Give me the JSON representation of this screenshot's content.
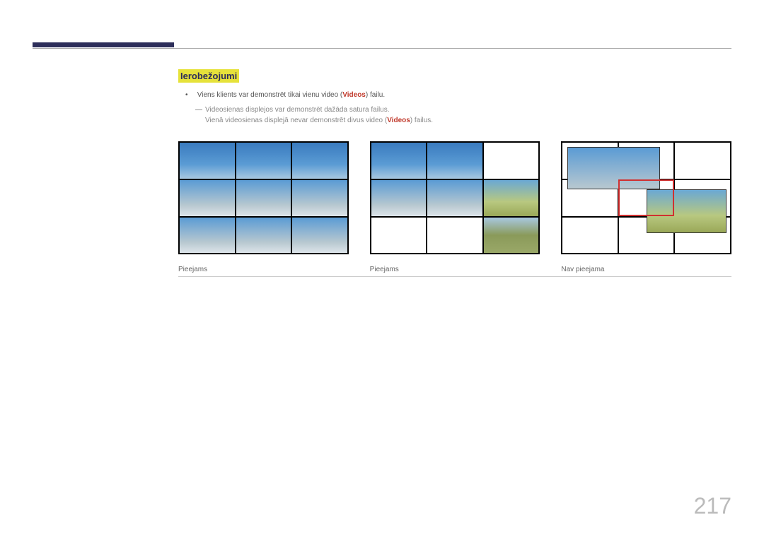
{
  "header": {},
  "section_title": "Ierobežojumi",
  "bullet1_pre": "Viens klients var demonstrēt tikai vienu video (",
  "bullet1_bold": "Videos",
  "bullet1_post": ") failu.",
  "subnote1": "Videosienas displejos var demonstrēt dažāda satura failus.",
  "subnote2_pre": "Vienā videosienas displejā nevar demonstrēt divus video (",
  "subnote2_bold": "Videos",
  "subnote2_post": ") failus.",
  "captions": {
    "g1": "Pieejams",
    "g2": "Pieejams",
    "g3": "Nav pieejama"
  },
  "page_number": "217"
}
